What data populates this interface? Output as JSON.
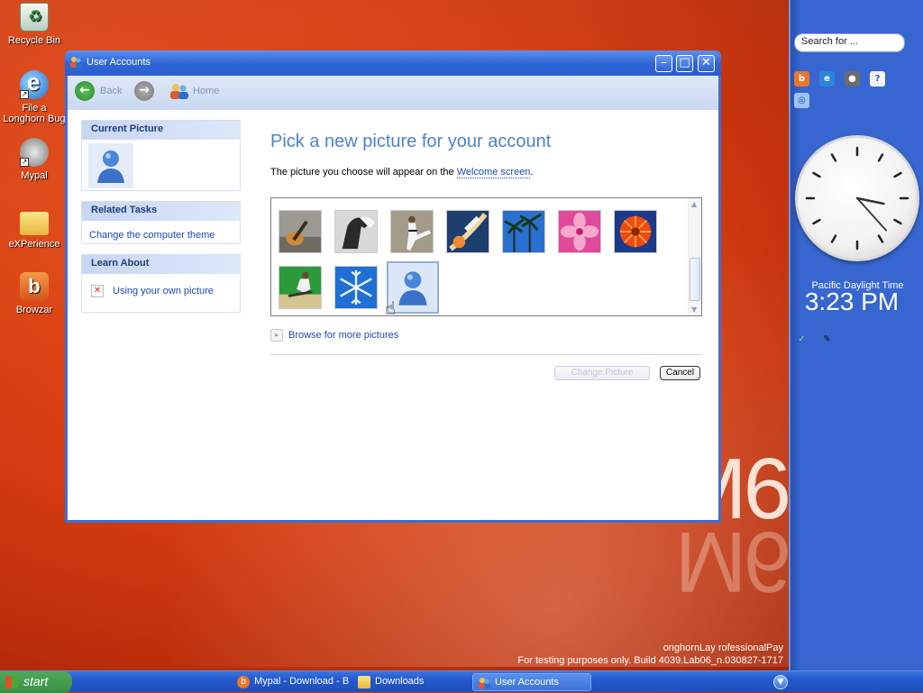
{
  "desktop": {
    "icons": [
      {
        "label": "Recycle Bin"
      },
      {
        "label": "File a Longhorn Bug"
      },
      {
        "label": "Mypal"
      },
      {
        "label": "eXPerience"
      },
      {
        "label": "Browzar"
      }
    ],
    "wallpaper_text": "M6",
    "watermark_line1": "onghornLay rofessionalPay",
    "watermark_line2": "For testing purposes only. Build 4039.Lab06_n.030827-1717"
  },
  "sidebar": {
    "search_placeholder": "Search for ...",
    "timezone": "Pacific Daylight Time",
    "time": "3:23 PM",
    "clock": {
      "hour": 3,
      "minute": 23
    }
  },
  "window": {
    "title": "User Accounts",
    "toolbar": {
      "back_label": "Back",
      "home_label": "Home"
    },
    "current_picture_heading": "Current Picture",
    "related_tasks_heading": "Related Tasks",
    "related_tasks_link": "Change the computer theme",
    "learn_about_heading": "Learn About",
    "learn_about_link": "Using your own picture",
    "heading": "Pick a new picture for your account",
    "subtext_before": "The picture you choose will appear on the ",
    "subtext_link": "Welcome screen",
    "subtext_after": ".",
    "pictures": [
      {
        "name": "guitar"
      },
      {
        "name": "horse"
      },
      {
        "name": "karate"
      },
      {
        "name": "space-shuttle"
      },
      {
        "name": "palm-trees"
      },
      {
        "name": "pink-flower"
      },
      {
        "name": "orange-flower"
      },
      {
        "name": "skateboarder"
      },
      {
        "name": "snowflake"
      },
      {
        "name": "msn-user",
        "selected": true
      }
    ],
    "browse_label": "Browse for more pictures",
    "change_button": "Change Picture",
    "cancel_button": "Cancel"
  },
  "taskbar": {
    "start_label": "start",
    "buttons": [
      {
        "label": "Mypal - Download - B"
      },
      {
        "label": "Downloads"
      },
      {
        "label": "User Accounts",
        "active": true
      }
    ]
  }
}
